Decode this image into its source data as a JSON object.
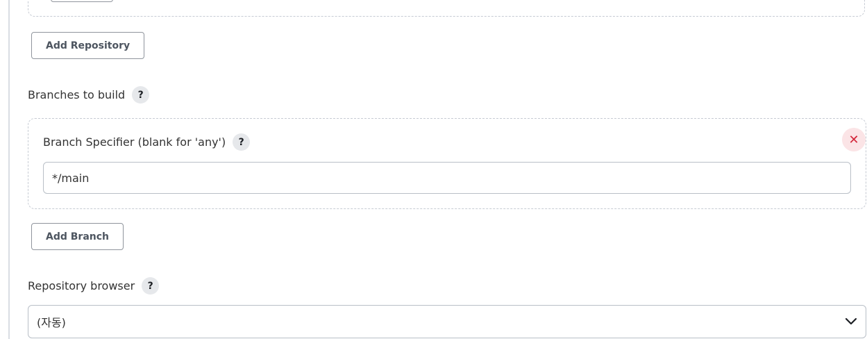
{
  "repositories": {
    "add_button_label": "Add Repository"
  },
  "branches": {
    "section_label": "Branches to build",
    "help_glyph": "?",
    "specifier_label": "Branch Specifier (blank for 'any')",
    "specifier_value": "*/main",
    "remove_glyph": "✕",
    "add_button_label": "Add Branch"
  },
  "repository_browser": {
    "label": "Repository browser",
    "selected_value": "(자동)"
  },
  "colors": {
    "remove_button_bg": "#fbe4e6",
    "remove_button_fg": "#d3263a",
    "help_bg": "#e6e8eb"
  },
  "icons": {
    "help": "question-mark-icon",
    "remove": "close-icon",
    "dropdown": "chevron-down-icon"
  }
}
